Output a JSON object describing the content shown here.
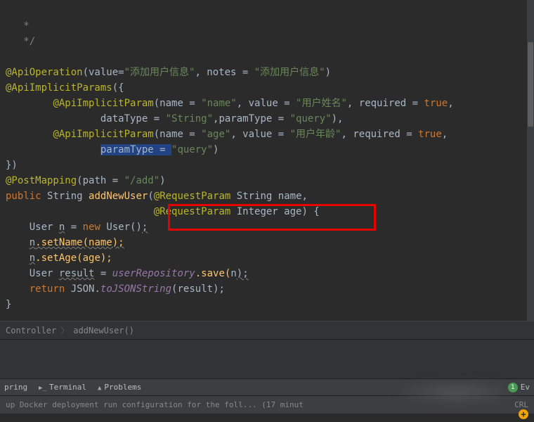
{
  "code": {
    "l1": "   *",
    "l2": "   */",
    "l3a": "@ApiOperation",
    "l3b": "(value=",
    "l3c": "\"添加用户信息\"",
    "l3d": ", notes = ",
    "l3e": "\"添加用户信息\"",
    "l3f": ")",
    "l4a": "@ApiImplicitParams",
    "l4b": "({",
    "l5a": "        ",
    "l5b": "@ApiImplicitParam",
    "l5c": "(name = ",
    "l5d": "\"name\"",
    "l5e": ", value = ",
    "l5f": "\"用户姓名\"",
    "l5g": ", required = ",
    "l5h": "true",
    "l5i": ",",
    "l6a": "                dataType = ",
    "l6b": "\"String\"",
    "l6c": ",paramType = ",
    "l6d": "\"query\"",
    "l6e": "),",
    "l7a": "        ",
    "l7b": "@ApiImplicitParam",
    "l7c": "(name = ",
    "l7d": "\"age\"",
    "l7e": ", value = ",
    "l7f": "\"用户年龄\"",
    "l7g": ", required = ",
    "l7h": "true",
    "l7i": ",",
    "l8a": "                ",
    "l8sel": "paramType = ",
    "l8b": "\"query\"",
    "l8c": ")",
    "l9": "})",
    "l10a": "@PostMapping",
    "l10b": "(path = ",
    "l10c": "\"/add\"",
    "l10d": ")",
    "l11a": "public ",
    "l11b": "String ",
    "l11c": "addNewUser",
    "l11d": "(",
    "l11e": "@RequestParam ",
    "l11f": "String name,",
    "l12a": "                         ",
    "l12b": "@RequestParam ",
    "l12c": "Integer age",
    "l12d": ") {",
    "l13a": "    User ",
    "l13b": "n",
    "l13c": " = ",
    "l13d": "new ",
    "l13e": "User()",
    "l13f": ";",
    "l14a": "    ",
    "l14b": "n",
    "l14c": ".setName(name);",
    "l15a": "    ",
    "l15b": "n",
    "l15c": ".setAge(age);",
    "l16a": "    User ",
    "l16b": "result",
    "l16c": " = ",
    "l16d": "userRepository",
    "l16e": ".save(",
    "l16f": "n",
    "l16g": ");",
    "l17a": "    ",
    "l17b": "return ",
    "l17c": "JSON",
    "l17d": ".",
    "l17e": "toJSONString",
    "l17f": "(",
    "l17g": "result",
    "l17h": ");",
    "l18": "}"
  },
  "breadcrumb": {
    "a": "Controller",
    "b": "addNewUser()"
  },
  "toolwindows": {
    "spring": "pring",
    "terminal": "Terminal",
    "problems": "Problems",
    "evcount": "1",
    "ev": "Ev"
  },
  "status": {
    "left": "up Docker deployment run configuration for the foll... (17 minut",
    "right": "CRL"
  }
}
